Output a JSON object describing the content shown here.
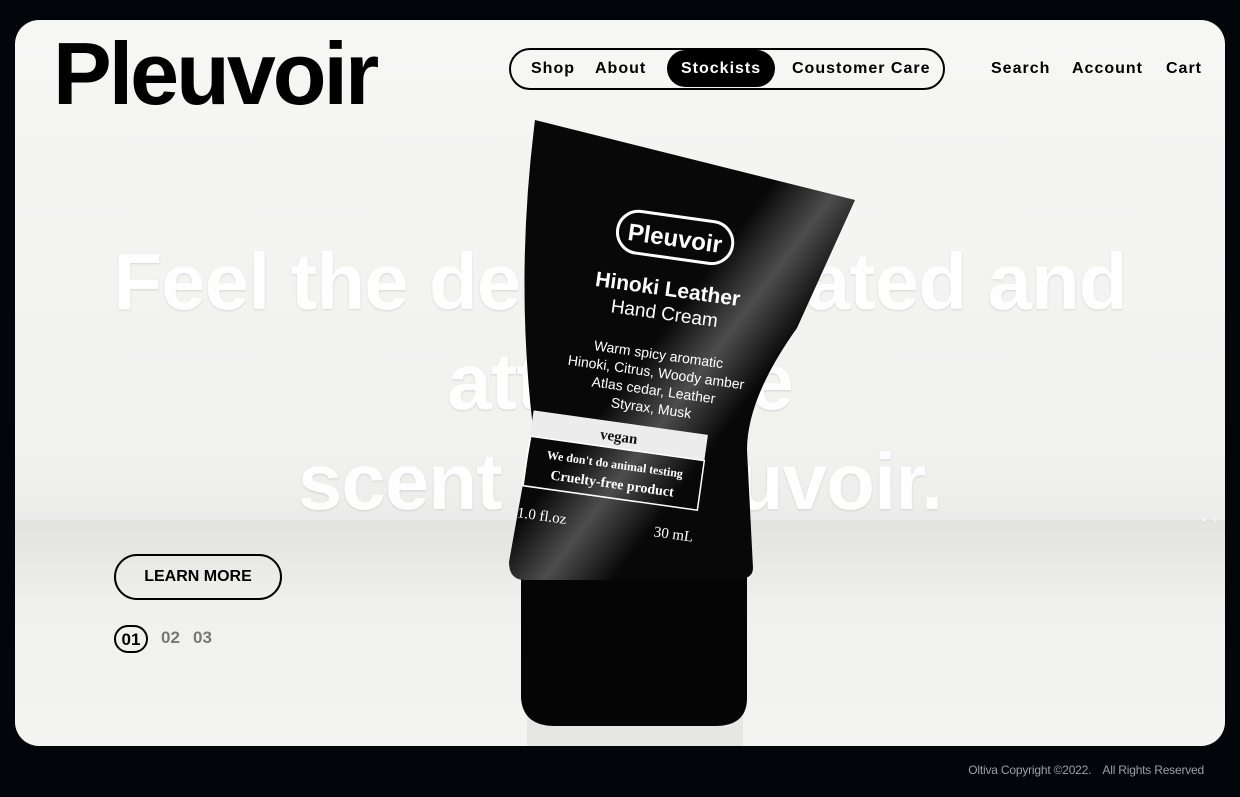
{
  "brand": {
    "logo_text": "Pleuvoir"
  },
  "nav": {
    "pill_items": [
      {
        "label": "Shop",
        "active": false
      },
      {
        "label": "About",
        "active": false
      },
      {
        "label": "Stockists",
        "active": true
      },
      {
        "label": "Coustomer Care",
        "active": false
      }
    ],
    "utility_items": [
      {
        "label": "Search"
      },
      {
        "label": "Account"
      },
      {
        "label": "Cart"
      }
    ]
  },
  "hero": {
    "headline_lines": [
      "Feel the deep, elevated and",
      "attractive",
      "scent of Pleuvoir."
    ],
    "cta_label": "LEARN MORE",
    "pagination": [
      {
        "label": "01",
        "active": true
      },
      {
        "label": "02",
        "active": false
      },
      {
        "label": "03",
        "active": false
      }
    ],
    "slider_dots": ". ."
  },
  "product": {
    "brand": "Pleuvoir",
    "name": "Hinoki Leather",
    "type": "Hand Cream",
    "notes": [
      "Warm spicy aromatic",
      "Hinoki, Citrus, Woody amber",
      "Atlas cedar, Leather",
      "Styrax, Musk"
    ],
    "badge": "vegan",
    "claim_lines": [
      "We don't do animal testing",
      "Cruelty-free product"
    ],
    "size_oz": "1.0 fl.oz",
    "size_ml": "30 mL"
  },
  "footer": {
    "copyright": "Oltiva Copyright ©2022.",
    "rights": "All Rights Reserved"
  },
  "colors": {
    "background": "#02060a",
    "panel": "#f4f4f2",
    "accent": "#000000",
    "muted": "#777777"
  }
}
